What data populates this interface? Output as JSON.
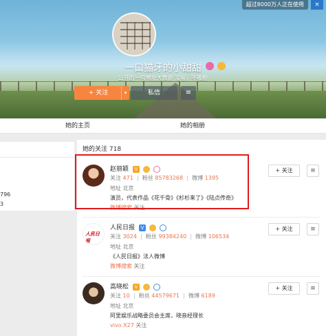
{
  "ad": {
    "text": "超过8000万人正在使用",
    "close": "×"
  },
  "profile": {
    "name": "一口猫牙的小甜甜",
    "bio": "公开的一句地址大数据",
    "bio_right": "没留，不收粉",
    "follow_label": "+ 关注",
    "follow_more": "▾",
    "message_label": "私信",
    "menu_icon": "≡"
  },
  "tabs": {
    "home": "她的主页",
    "album": "她的相册"
  },
  "left": {
    "line1": "796",
    "line2": "3"
  },
  "following": {
    "title": "她的关注 718",
    "users": [
      {
        "name": "赵丽颖",
        "following_label": "关注",
        "following": "471",
        "fans_label": "粉丝",
        "fans": "85783268",
        "weibo_label": "微博",
        "weibo": "1395",
        "address_label": "地址",
        "address": "北京",
        "desc": "演员，代表作品《花千骨》《杉杉来了》《陆贞传奇》",
        "src": "",
        "src_link": "微博搜索",
        "src_suffix": "关注",
        "follow_btn": "+ 关注",
        "menu_btn": "≡",
        "accent": "#c23a2b"
      },
      {
        "name": "人民日报",
        "following_label": "关注",
        "following": "3024",
        "fans_label": "粉丝",
        "fans": "99384240",
        "weibo_label": "微博",
        "weibo": "106534",
        "address_label": "地址",
        "address": "北京",
        "desc": "《人民日报》法人微博",
        "src": "",
        "src_link": "微博搜索",
        "src_suffix": "关注",
        "follow_btn": "+ 关注",
        "menu_btn": "≡",
        "accent": "#cf2a1f"
      },
      {
        "name": "高晓松",
        "following_label": "关注",
        "following": "10",
        "fans_label": "粉丝",
        "fans": "44579671",
        "weibo_label": "微博",
        "weibo": "6189",
        "address_label": "地址",
        "address": "北京",
        "desc": "阿里娱乐战略委员会主席，晓音经理长",
        "src": "",
        "src_link": "vivo X27",
        "src_suffix": "关注",
        "follow_btn": "+ 关注",
        "menu_btn": "≡",
        "accent": "#8a5a2a"
      }
    ]
  }
}
